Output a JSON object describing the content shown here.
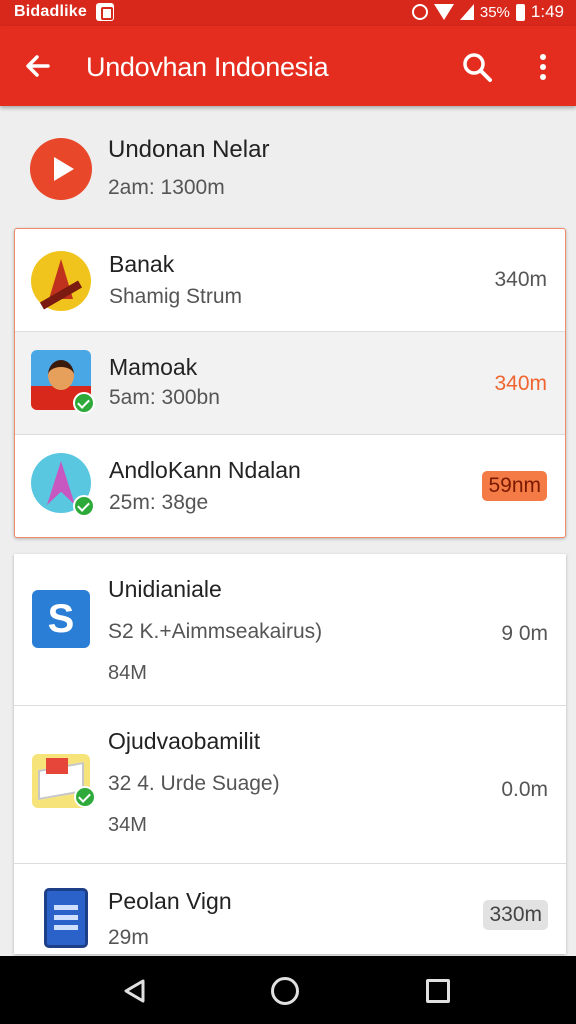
{
  "status_bar": {
    "carrier": "Bidadlike",
    "battery": "35%",
    "time": "1:49"
  },
  "app_bar": {
    "title": "Undovhan Indonesia",
    "icons": [
      "back-arrow-icon",
      "search-icon",
      "more-vert-icon"
    ]
  },
  "featured": {
    "title": "Undonan Nelar",
    "subtitle": "2am: 1300m",
    "icon": "play-icon"
  },
  "card1": {
    "items": [
      {
        "name": "Banak",
        "sub": "Shamig Strum",
        "size": "340m",
        "icon": "temple-app-icon"
      },
      {
        "name": "Mamoak",
        "sub": "5am: 300bn",
        "size": "340m",
        "icon": "game-character-app-icon"
      },
      {
        "name": "AndloKann Ndalan",
        "sub": "25m: 38ge",
        "size": "59nm",
        "icon": "pink-shape-app-icon"
      }
    ]
  },
  "card2": {
    "items": [
      {
        "name": "Unidianiale",
        "sub": "S2 K.+Aimmseakairus)",
        "sub2": "84M",
        "size": "9 0m",
        "icon": "s-app-icon"
      },
      {
        "name": "Ojudvaobamilit",
        "sub": "32 4. Urde Suage)",
        "sub2": "34M",
        "size": "0.0m",
        "icon": "package-app-icon"
      },
      {
        "name": "Peolan Vign",
        "sub": "29m",
        "size": "330m",
        "icon": "document-app-icon"
      }
    ]
  },
  "colors": {
    "primary": "#e42d1f",
    "status_bar": "#d8281c",
    "accent_orange": "#f0642f",
    "check_green": "#2eaa3a"
  },
  "nav_bar": {
    "icons": [
      "nav-back-icon",
      "nav-home-icon",
      "nav-recents-icon"
    ]
  }
}
